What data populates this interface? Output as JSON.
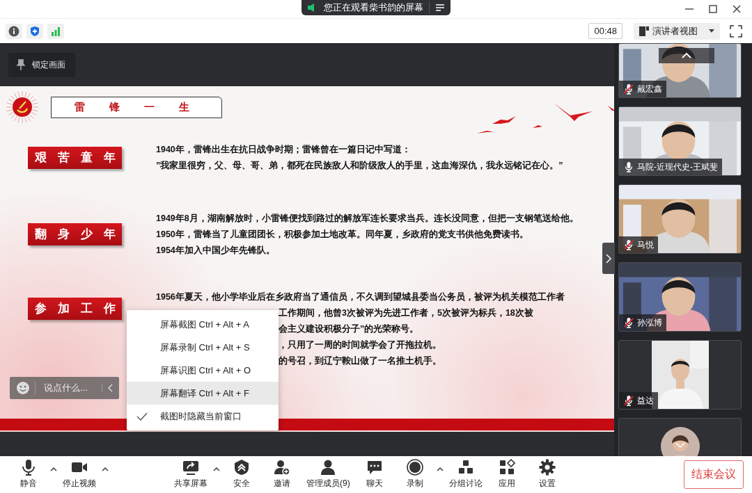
{
  "title_bar": {
    "banner": "您正在观看柴书韵的屏幕"
  },
  "toolbar": {
    "timer": "00:48",
    "view_mode": "演讲者视图"
  },
  "lock_button": "锁定画面",
  "slide": {
    "title": "雷锋一生",
    "sections": [
      {
        "label": "艰苦童年",
        "lines": [
          "1940年，雷锋出生在抗日战争时期；雷锋曾在一篇日记中写道：",
          "”我家里很穷，父、母、哥、弟，都死在民族敌人和阶级敌人的手里，这血海深仇，我永远铭记在心。”"
        ]
      },
      {
        "label": "翻身少年",
        "lines": [
          "1949年8月，湖南解放时，小雷锋便找到路过的解放军连长要求当兵。连长没同意，但把一支钢笔送给他。",
          "1950年，雷锋当了儿童团团长，积极参加土地改革。同年夏，乡政府的党支书供他免费读书。",
          "1954年加入中国少年先锋队。"
        ]
      },
      {
        "label": "参加工作",
        "lines": [
          "1956年夏天，他小学毕业后在乡政府当了通信员，不久调到望城县委当公务员，被评为机关模范工作者"
        ],
        "lines_behind_menu": [
          "工作期间，他曾3次被评为先进工作者，5次被评为标兵，18次被",
          "会主义建设积极分子”的光荣称号。",
          "，只用了一周的时间就学会了开拖拉机。",
          "的号召，到辽宁鞍山做了一名推土机手。"
        ]
      }
    ]
  },
  "chat_input": {
    "placeholder": "说点什么..."
  },
  "context_menu": [
    {
      "label": "屏幕截图 Ctrl + Alt + A",
      "checked": false,
      "selected": false
    },
    {
      "label": "屏幕录制 Ctrl + Alt + S",
      "checked": false,
      "selected": false
    },
    {
      "label": "屏幕识图 Ctrl + Alt + O",
      "checked": false,
      "selected": false
    },
    {
      "label": "屏幕翻译 Ctrl + Alt + F",
      "checked": false,
      "selected": true
    },
    {
      "label": "截图时隐藏当前窗口",
      "checked": true,
      "selected": false
    }
  ],
  "participants": [
    {
      "kind": "video",
      "name": "戴宏鑫",
      "muted": true
    },
    {
      "kind": "video",
      "name": "马院-近现代史-王斌斐",
      "muted": false
    },
    {
      "kind": "video",
      "name": "马悦",
      "muted": true
    },
    {
      "kind": "video",
      "name": "孙泓博",
      "muted": true
    },
    {
      "kind": "portrait",
      "name": "益达",
      "muted": true
    },
    {
      "kind": "avatar"
    }
  ],
  "bottom_bar": {
    "items": [
      {
        "kind": "mic",
        "label": "静音",
        "has_menu": true
      },
      {
        "kind": "camera",
        "label": "停止视频",
        "has_menu": true
      },
      {
        "kind": "share",
        "label": "共享屏幕",
        "has_menu": true
      },
      {
        "kind": "shield",
        "label": "安全",
        "has_menu": false
      },
      {
        "kind": "invite",
        "label": "邀请",
        "has_menu": false
      },
      {
        "kind": "members",
        "label": "管理成员(9)",
        "has_menu": false
      },
      {
        "kind": "chat",
        "label": "聊天",
        "has_menu": false
      },
      {
        "kind": "record",
        "label": "录制",
        "has_menu": true
      },
      {
        "kind": "breakout",
        "label": "分组讨论",
        "has_menu": false
      },
      {
        "kind": "apps",
        "label": "应用",
        "has_menu": false
      },
      {
        "kind": "settings",
        "label": "设置",
        "has_menu": false
      }
    ],
    "end_button": "结束会议"
  }
}
